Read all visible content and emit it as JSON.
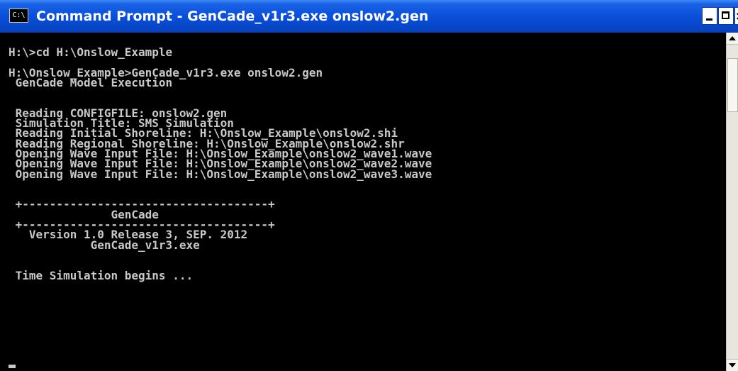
{
  "window": {
    "title": "Command Prompt - GenCade_v1r3.exe onslow2.gen",
    "icon_label": "C:\\",
    "close_glyph": "×"
  },
  "console": {
    "lines": [
      "H:\\>cd H:\\Onslow_Example",
      "",
      "H:\\Onslow_Example>GenCade_v1r3.exe onslow2.gen",
      " GenCade Model Execution",
      "",
      "",
      " Reading CONFIGFILE: onslow2.gen",
      " Simulation Title: SMS Simulation",
      " Reading Initial Shoreline: H:\\Onslow_Example\\onslow2.shi",
      " Reading Regional Shoreline: H:\\Onslow_Example\\onslow2.shr",
      " Opening Wave Input File: H:\\Onslow_Example\\onslow2_wave1.wave",
      " Opening Wave Input File: H:\\Onslow_Example\\onslow2_wave2.wave",
      " Opening Wave Input File: H:\\Onslow_Example\\onslow2_wave3.wave",
      "",
      "",
      " +------------------------------------+",
      "               GenCade",
      " +------------------------------------+",
      "   Version 1.0 Release 3, SEP. 2012",
      "            GenCade_v1r3.exe",
      "",
      "",
      " Time Simulation begins ..."
    ]
  },
  "colors": {
    "console_background": "#000000",
    "console_text": "#c8c8c8",
    "titlebar_blue": "#0a4fd8"
  },
  "icons": {
    "title_icon": "command-prompt-icon",
    "minimize": "minimize-icon",
    "maximize": "maximize-icon",
    "close": "close-icon",
    "scroll_up": "arrow-up-icon",
    "scroll_down": "arrow-down-icon"
  }
}
